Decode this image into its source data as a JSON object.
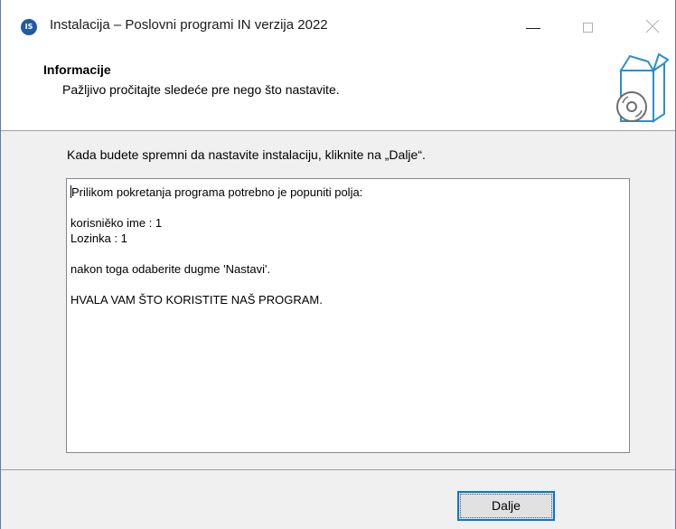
{
  "window": {
    "title": "Instalacija – Poslovni programi IN verzija 2022",
    "icon_text": "IS",
    "icon_color": "#1e5aa8",
    "accent_color": "#0078d7"
  },
  "header": {
    "title": "Informacije",
    "subtitle": "Pažljivo pročitajte sledeće pre nego što nastavite."
  },
  "main": {
    "instruction": "Kada budete spremni da nastavite instalaciju, kliknite na „Dalje“.",
    "memo_lines": [
      "Prilikom pokretanja programa potrebno je popuniti polja:",
      "",
      "korisniěko ime : 1",
      "Lozinka : 1",
      "",
      "nakon toga odaberite dugme 'Nastavi'.",
      "",
      "HVALA VAM ŠTO KORISTITE NAŠ PROGRAM."
    ]
  },
  "footer": {
    "next_label": "Dalje"
  }
}
